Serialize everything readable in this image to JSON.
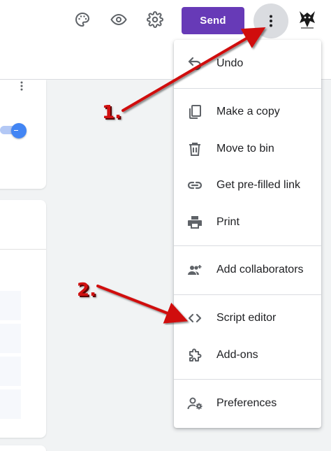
{
  "toolbar": {
    "send_label": "Send",
    "icons": [
      "palette-icon",
      "eye-icon",
      "gear-icon",
      "more-vert-icon"
    ]
  },
  "menu": {
    "items": [
      {
        "label": "Undo",
        "icon": "undo-icon"
      },
      {
        "label": "Make a copy",
        "icon": "copy-icon"
      },
      {
        "label": "Move to bin",
        "icon": "trash-icon"
      },
      {
        "label": "Get pre-filled link",
        "icon": "link-icon"
      },
      {
        "label": "Print",
        "icon": "print-icon"
      },
      {
        "label": "Add collaborators",
        "icon": "add-people-icon"
      },
      {
        "label": "Script editor",
        "icon": "code-icon"
      },
      {
        "label": "Add-ons",
        "icon": "puzzle-icon"
      },
      {
        "label": "Preferences",
        "icon": "person-settings-icon"
      }
    ]
  },
  "annotations": {
    "step1": "1.",
    "step2": "2."
  },
  "colors": {
    "accent": "#673ab7",
    "annotation": "#d01010",
    "toggle": "#4285f4"
  }
}
